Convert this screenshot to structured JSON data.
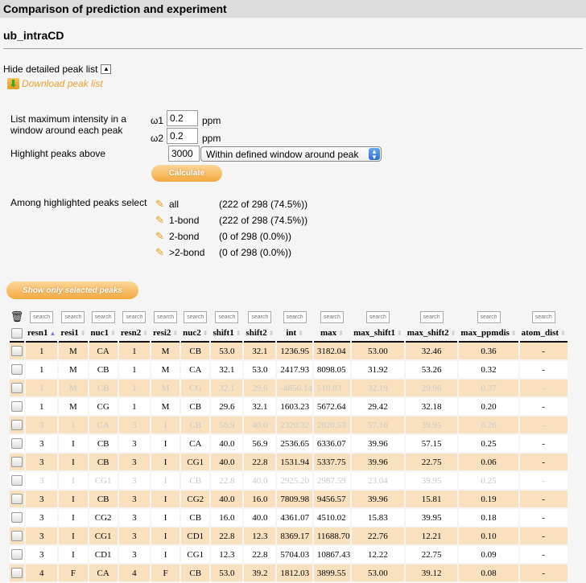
{
  "titlebar": {
    "title": "Comparison of prediction and experiment"
  },
  "subtitle": "ub_intraCD",
  "peak_list": {
    "hide_label": "Hide detailed peak list",
    "toggle_icon": "chevron-up",
    "download_label": "Download peak list"
  },
  "form": {
    "window_label": "List maximum intensity in a window around each peak",
    "w1_label": "ω1",
    "w1_value": "0.2",
    "w2_label": "ω2",
    "w2_value": "0.2",
    "unit": "ppm",
    "highlight_label": "Highlight peaks above",
    "highlight_value": "3000",
    "mode_selected": "Within defined window around peak",
    "calculate_label": "Calculate"
  },
  "selection": {
    "label": "Among highlighted peaks select",
    "options": [
      {
        "label": "all",
        "count": "(222 of 298 (74.5%))"
      },
      {
        "label": "1-bond",
        "count": "(222 of 298 (74.5%))"
      },
      {
        "label": "2-bond",
        "count": "(0 of 298 (0.0%))"
      },
      {
        "label": ">2-bond",
        "count": "(0 of 298 (0.0%))"
      }
    ],
    "show_selected_label": "Show only selected peaks"
  },
  "table": {
    "search_placeholder": "search",
    "columns": [
      "resn1",
      "resi1",
      "nuc1",
      "resn2",
      "resi2",
      "nuc2",
      "shift1",
      "shift2",
      "int",
      "max",
      "max_shift1",
      "max_shift2",
      "max_ppmdis",
      "atom_dist"
    ],
    "sorted_column": "resn1",
    "rows": [
      {
        "style": "hl",
        "cells": [
          "1",
          "M",
          "CA",
          "1",
          "M",
          "CB",
          "53.0",
          "32.1",
          "1236.95",
          "3182.04",
          "53.00",
          "32.46",
          "0.36",
          "-"
        ]
      },
      {
        "style": "plain",
        "cells": [
          "1",
          "M",
          "CB",
          "1",
          "M",
          "CA",
          "32.1",
          "53.0",
          "2417.93",
          "8098.05",
          "31.92",
          "53.26",
          "0.32",
          "-"
        ]
      },
      {
        "style": "hl dim",
        "cells": [
          "1",
          "M",
          "CB",
          "1",
          "M",
          "CG",
          "32.1",
          "29.6",
          "-4856.14",
          "510.03",
          "32.19",
          "29.96",
          "0.37",
          "-"
        ]
      },
      {
        "style": "plain",
        "cells": [
          "1",
          "M",
          "CG",
          "1",
          "M",
          "CB",
          "29.6",
          "32.1",
          "1603.23",
          "5672.64",
          "29.42",
          "32.18",
          "0.20",
          "-"
        ]
      },
      {
        "style": "hl dim",
        "cells": [
          "3",
          "I",
          "CA",
          "3",
          "I",
          "CB",
          "56.9",
          "40.0",
          "2320.32",
          "2820.53",
          "57.16",
          "39.95",
          "0.26",
          "-"
        ]
      },
      {
        "style": "plain",
        "cells": [
          "3",
          "I",
          "CB",
          "3",
          "I",
          "CA",
          "40.0",
          "56.9",
          "2536.65",
          "6336.07",
          "39.96",
          "57.15",
          "0.25",
          "-"
        ]
      },
      {
        "style": "hl",
        "cells": [
          "3",
          "I",
          "CB",
          "3",
          "I",
          "CG1",
          "40.0",
          "22.8",
          "1531.94",
          "5337.75",
          "39.96",
          "22.75",
          "0.06",
          "-"
        ]
      },
      {
        "style": "plain dim",
        "cells": [
          "3",
          "I",
          "CG1",
          "3",
          "I",
          "CB",
          "22.8",
          "40.0",
          "2925.20",
          "2987.59",
          "23.04",
          "39.95",
          "0.25",
          "-"
        ]
      },
      {
        "style": "hl",
        "cells": [
          "3",
          "I",
          "CB",
          "3",
          "I",
          "CG2",
          "40.0",
          "16.0",
          "7809.98",
          "9456.57",
          "39.96",
          "15.81",
          "0.19",
          "-"
        ]
      },
      {
        "style": "plain",
        "cells": [
          "3",
          "I",
          "CG2",
          "3",
          "I",
          "CB",
          "16.0",
          "40.0",
          "4361.07",
          "4510.02",
          "15.83",
          "39.95",
          "0.18",
          "-"
        ]
      },
      {
        "style": "hl",
        "cells": [
          "3",
          "I",
          "CG1",
          "3",
          "I",
          "CD1",
          "22.8",
          "12.3",
          "8369.17",
          "11688.70",
          "22.76",
          "12.21",
          "0.10",
          "-"
        ]
      },
      {
        "style": "plain",
        "cells": [
          "3",
          "I",
          "CD1",
          "3",
          "I",
          "CG1",
          "12.3",
          "22.8",
          "5704.03",
          "10867.43",
          "12.22",
          "22.75",
          "0.09",
          "-"
        ]
      },
      {
        "style": "hl",
        "cells": [
          "4",
          "F",
          "CA",
          "4",
          "F",
          "CB",
          "53.0",
          "39.2",
          "1812.03",
          "3899.55",
          "53.00",
          "39.12",
          "0.08",
          "-"
        ]
      }
    ]
  },
  "colors": {
    "highlight_row": "#f9e1c0",
    "accent_orange": "#f4a940",
    "link_orange": "#f0a030"
  }
}
